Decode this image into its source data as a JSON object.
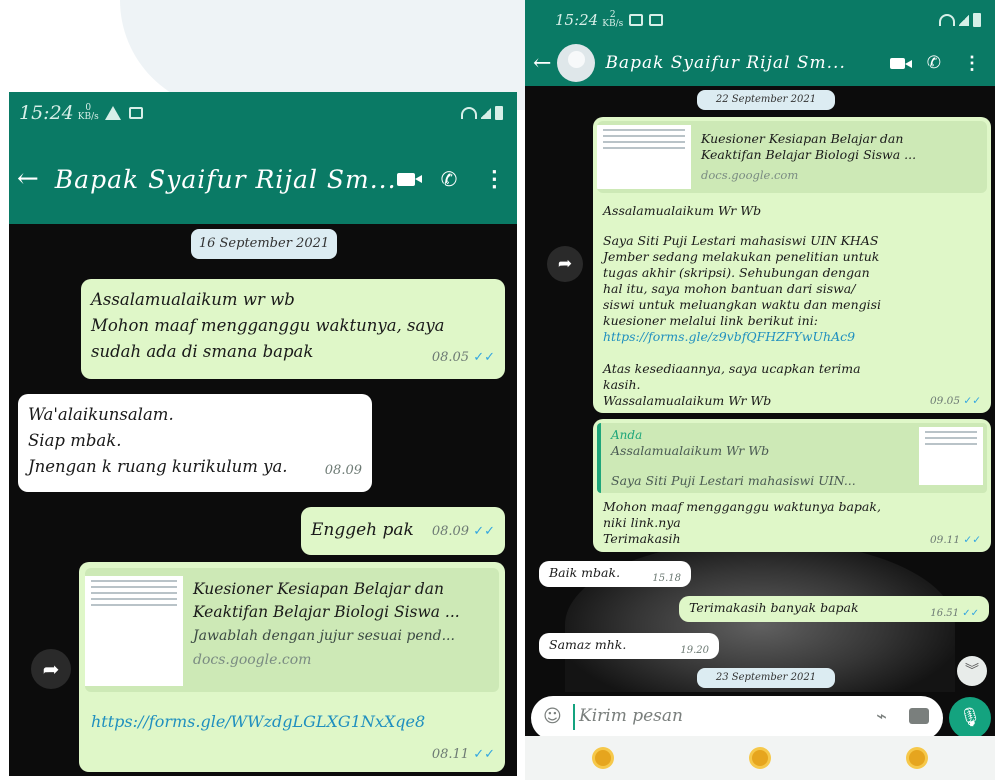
{
  "left_phone": {
    "status": {
      "time": "15:24",
      "speed_value": "0",
      "speed_unit": "KB/s"
    },
    "header": {
      "contact_name": "Bapak Syaifur Rijal Sm..."
    },
    "date_chip": "16 September 2021",
    "messages": [
      {
        "lines": [
          "Assalamualaikum wr wb",
          "Mohon maaf mengganggu waktunya, saya",
          "sudah ada di smana bapak"
        ],
        "time": "08.05"
      },
      {
        "lines": [
          "Wa'alaikunsalam.",
          "Siap mbak.",
          "Jnengan k ruang kurikulum ya."
        ],
        "time": "08.09"
      },
      {
        "lines": [
          "Enggeh pak"
        ],
        "time": "08.09"
      }
    ],
    "link_message": {
      "preview_title": [
        "Kuesioner Kesiapan Belajar dan",
        "Keaktifan Belajar Biologi Siswa ..."
      ],
      "preview_desc": "Jawablah dengan jujur sesuai pend...",
      "preview_domain": "docs.google.com",
      "url": "https://forms.gle/WWzdgLGLXG1NxXqe8",
      "time": "08.11"
    }
  },
  "right_phone": {
    "status": {
      "time": "15:24",
      "speed_value": "2",
      "speed_unit": "KB/s"
    },
    "header": {
      "contact_name": "Bapak Syaifur Rijal Sm..."
    },
    "date_chip_1": "22 September 2021",
    "forwarded": {
      "preview_title": [
        "Kuesioner Kesiapan Belajar dan",
        "Keaktifan Belajar Biologi Siswa ..."
      ],
      "preview_domain": "docs.google.com",
      "greeting": "Assalamualaikum Wr Wb",
      "body": [
        "Saya Siti Puji Lestari mahasiswi UIN KHAS",
        "Jember sedang melakukan penelitian untuk",
        "tugas akhir (skripsi). Sehubungan dengan",
        "hal itu, saya mohon bantuan dari siswa/",
        "siswi untuk meluangkan waktu dan mengisi",
        "kuesioner melalui link berikut ini:"
      ],
      "url": "https://forms.gle/z9vbfQFHZFYwUhAc9",
      "closing": [
        "Atas kesediaannya, saya ucapkan terima",
        "kasih."
      ],
      "signoff": "Wassalamualaikum Wr Wb",
      "time": "09.05"
    },
    "reply": {
      "quote_author": "Anda",
      "quote_line1": "Assalamualaikum Wr Wb",
      "quote_line2": "Saya Siti Puji Lestari mahasiswi UIN...",
      "lines": [
        "Mohon maaf mengganggu waktunya bapak,",
        "niki link.nya",
        "Terimakasih"
      ],
      "time": "09.11"
    },
    "msg_baik": {
      "text": "Baik mbak.",
      "time": "15.18"
    },
    "msg_terima": {
      "text": "Terimakasih banyak bapak",
      "time": "16.51"
    },
    "msg_samaz": {
      "text": "Samaz mhk.",
      "time": "19.20"
    },
    "date_chip_2": "23 September 2021",
    "input_placeholder": "Kirim pesan"
  },
  "colors": {
    "whatsapp_green": "#0a7a65",
    "outgoing_bubble": "#dff7c8",
    "incoming_bubble": "#ffffff",
    "tick_blue": "#33a6e0"
  }
}
